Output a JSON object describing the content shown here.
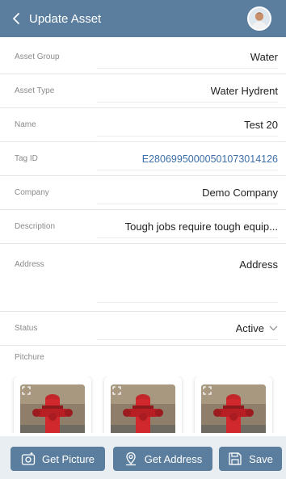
{
  "header": {
    "title": "Update Asset",
    "back_icon": "chevron-left-icon",
    "avatar_icon": "user-avatar"
  },
  "form": {
    "asset_group": {
      "label": "Asset Group",
      "value": "Water"
    },
    "asset_type": {
      "label": "Asset Type",
      "value": "Water Hydrent"
    },
    "name": {
      "label": "Name",
      "value": "Test 20"
    },
    "tag_id": {
      "label": "Tag ID",
      "value": "E2806995000050107301412​6"
    },
    "company": {
      "label": "Company",
      "value": "Demo Company"
    },
    "description": {
      "label": "Description",
      "value": "Tough jobs require tough equip..."
    },
    "address": {
      "label": "Address",
      "value": "Address"
    },
    "status": {
      "label": "Status",
      "value": "Active"
    }
  },
  "pictures": {
    "label": "Pitchure",
    "items": [
      "fire-hydrant-photo",
      "fire-hydrant-photo",
      "fire-hydrant-photo"
    ]
  },
  "actions": {
    "get_picture": "Get Picture",
    "get_address": "Get Address",
    "save": "Save"
  },
  "colors": {
    "header": "#5b7e9e",
    "link": "#3d6fa8",
    "bottom_bar": "#e9eef3"
  }
}
